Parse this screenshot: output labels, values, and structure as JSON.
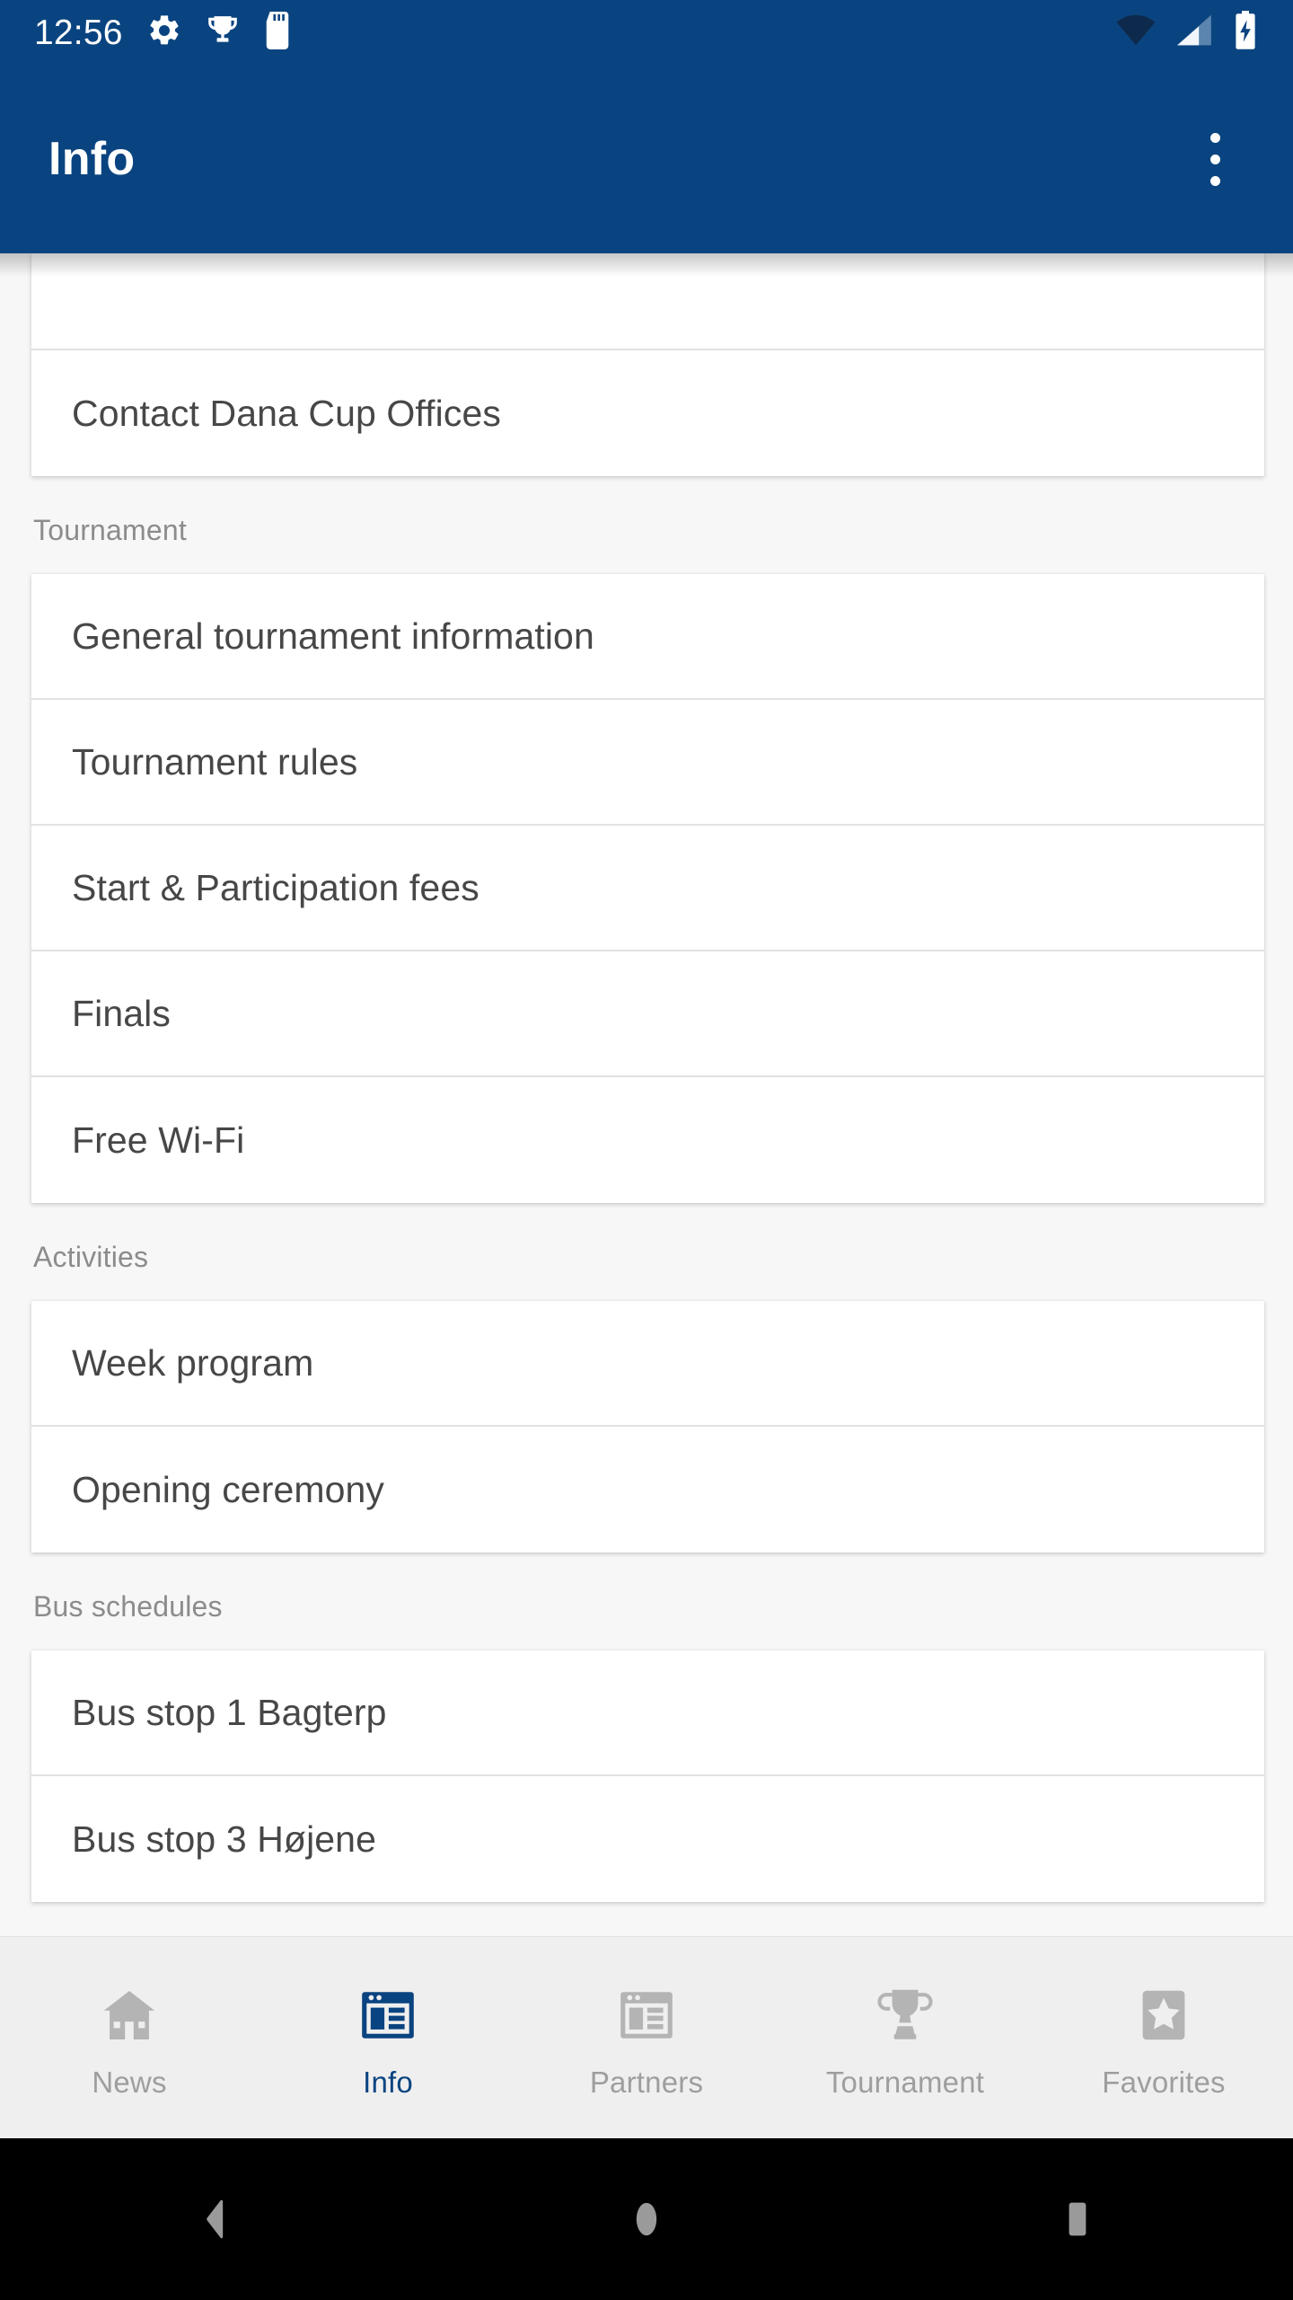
{
  "status_bar": {
    "time": "12:56",
    "left_icons": [
      "settings-gear-icon",
      "trophy-icon",
      "sd-card-icon"
    ],
    "right_icons": [
      "wifi-icon",
      "cellular-signal-icon",
      "battery-charging-icon"
    ],
    "background_color": "#0a4480"
  },
  "app_bar": {
    "title": "Info",
    "overflow_menu_label": "More options",
    "background_color": "#0a4480",
    "title_color": "#ffffff"
  },
  "content": {
    "groups": [
      {
        "header": null,
        "items": [
          {
            "label": "",
            "partial": true
          },
          {
            "label": "Contact Dana Cup Offices",
            "partial": false
          }
        ]
      },
      {
        "header": "Tournament",
        "items": [
          {
            "label": "General tournament information",
            "partial": false
          },
          {
            "label": "Tournament rules",
            "partial": false
          },
          {
            "label": "Start & Participation fees",
            "partial": false
          },
          {
            "label": "Finals",
            "partial": false
          },
          {
            "label": "Free Wi-Fi",
            "partial": false
          }
        ]
      },
      {
        "header": "Activities",
        "items": [
          {
            "label": "Week program",
            "partial": false
          },
          {
            "label": "Opening ceremony",
            "partial": false
          }
        ]
      },
      {
        "header": "Bus schedules",
        "items": [
          {
            "label": "Bus stop 1 Bagterp",
            "partial": false
          },
          {
            "label": "Bus stop 3 Højene",
            "partial": false
          }
        ]
      }
    ],
    "section_header_color": "#8c8c8c",
    "item_text_color": "#474747",
    "background_color": "#f7f7f7"
  },
  "bottom_nav": {
    "active_index": 1,
    "active_color": "#0a4480",
    "inactive_color": "#b4b4b4",
    "label_inactive_color": "#9e9e9e",
    "items": [
      {
        "label": "News",
        "icon": "home-icon"
      },
      {
        "label": "Info",
        "icon": "article-page-icon"
      },
      {
        "label": "Partners",
        "icon": "article-page-icon"
      },
      {
        "label": "Tournament",
        "icon": "trophy-icon"
      },
      {
        "label": "Favorites",
        "icon": "star-badge-icon"
      }
    ]
  },
  "system_nav": {
    "back_label": "Back",
    "home_label": "Home",
    "recents_label": "Recent apps",
    "icon_color": "#9a9a9a",
    "background_color": "#000000"
  }
}
